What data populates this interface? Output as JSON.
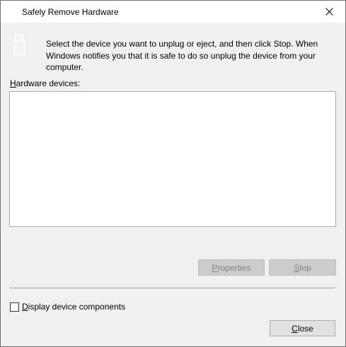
{
  "window": {
    "title": "Safely Remove Hardware"
  },
  "icons": {
    "device": "usb-drive-icon",
    "close": "close-icon"
  },
  "instructions": "Select the device you want to unplug or eject, and then click Stop. When Windows notifies you that it is safe to do so unplug the device from your computer.",
  "hardware_list": {
    "label_accel": "H",
    "label_rest": "ardware devices:",
    "items": []
  },
  "buttons": {
    "properties": {
      "accel": "P",
      "rest": "roperties",
      "enabled": false
    },
    "stop": {
      "accel": "S",
      "rest": "top",
      "enabled": false
    },
    "close": {
      "accel": "C",
      "rest": "lose",
      "enabled": true
    }
  },
  "display_components": {
    "accel": "D",
    "rest": "isplay device components",
    "checked": false
  }
}
